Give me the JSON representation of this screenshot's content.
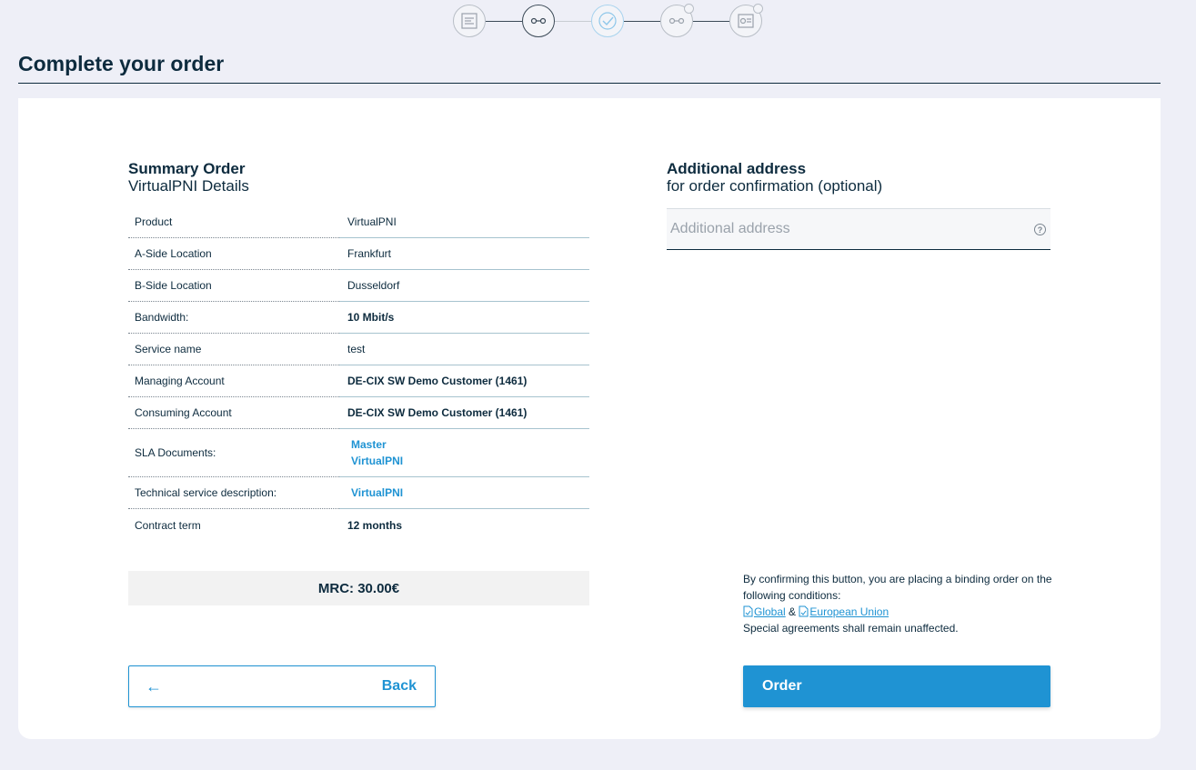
{
  "stepper": {
    "steps": [
      {
        "icon": "server-list-icon",
        "state": "inactive"
      },
      {
        "icon": "connection-link-icon",
        "state": "current"
      },
      {
        "icon": "check-circle-icon",
        "state": "done"
      },
      {
        "icon": "connection-link-icon",
        "state": "inactive"
      },
      {
        "icon": "settings-document-icon",
        "state": "inactive"
      }
    ]
  },
  "page": {
    "title": "Complete your order"
  },
  "summary": {
    "title": "Summary Order",
    "subtitle": "VirtualPNI Details",
    "rows": [
      {
        "label": "Product",
        "value": "VirtualPNI"
      },
      {
        "label": "A-Side Location",
        "value": "Frankfurt"
      },
      {
        "label": "B-Side Location",
        "value": "Dusseldorf"
      },
      {
        "label": "Bandwidth:",
        "value": "10 Mbit/s"
      },
      {
        "label": "Service name",
        "value": "test"
      },
      {
        "label": "Managing Account",
        "value": "DE-CIX SW Demo Customer (1461)"
      },
      {
        "label": "Consuming Account",
        "value": "DE-CIX SW Demo Customer (1461)"
      },
      {
        "label": "SLA Documents:",
        "links": [
          "Master",
          "VirtualPNI"
        ]
      },
      {
        "label": "Technical service description:",
        "links": [
          "VirtualPNI"
        ]
      },
      {
        "label": "Contract term",
        "value": "12 months"
      }
    ],
    "mrc": "MRC: 30.00€"
  },
  "additional_address": {
    "title": "Additional address",
    "subtitle": "for order confirmation (optional)",
    "placeholder": "Additional address",
    "value": ""
  },
  "terms": {
    "line1": "By confirming this button, you are placing a binding order on the following conditions:",
    "link_global": "Global",
    "separator": "&",
    "link_eu": "European Union",
    "line2": "Special agreements shall remain unaffected."
  },
  "buttons": {
    "back_arrow": "←",
    "back_label": "Back",
    "order_label": "Order"
  },
  "colors": {
    "accent": "#1f93d3",
    "text": "#0d2b3e",
    "background": "#eeeff7"
  }
}
